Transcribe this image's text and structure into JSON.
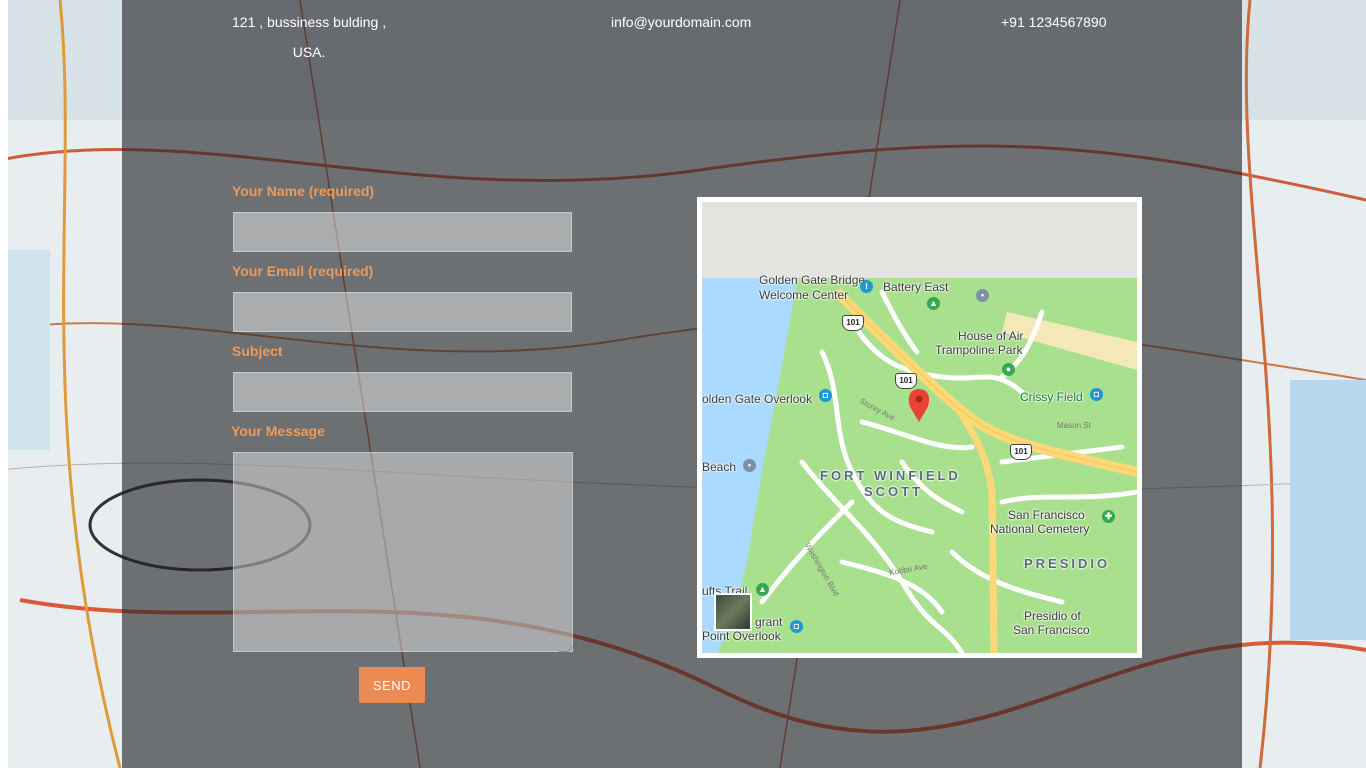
{
  "contact": {
    "address_line1": "121 , bussiness bulding ,",
    "address_line2": "USA.",
    "email": "info@yourdomain.com",
    "phone": "+91 1234567890"
  },
  "form": {
    "name_label": "Your Name (required)",
    "email_label": "Your Email (required)",
    "subject_label": "Subject",
    "message_label": "Your Message",
    "name_value": "",
    "email_value": "",
    "subject_value": "",
    "message_value": "",
    "send_label": "SEND"
  },
  "map": {
    "labels": {
      "golden_gate_bridge": "Golden Gate Bridge",
      "welcome_center": "Welcome Center",
      "battery_east": "Battery East",
      "house_of_air": "House of Air",
      "trampoline_park": "Trampoline Park",
      "golden_gate_overlook": "olden Gate Overlook",
      "crissy_field": "Crissy Field",
      "beach": "Beach",
      "fort_winfield": "FORT WINFIELD",
      "scott": "SCOTT",
      "sf_national": "San Francisco",
      "national_cemetery": "National Cemetery",
      "presidio": "PRESIDIO",
      "presidio_of": "Presidio of",
      "presidio_sf": "San Francisco",
      "trail": "ufts Trail",
      "immigrant": "grant",
      "point_overlook": "Point Overlook",
      "storey_ave": "Storey Ave",
      "mason_st": "Mason St",
      "kobbe_ave": "Kobbe Ave",
      "washington_blvd": "Washington Blvd",
      "lincoln_blvd": "Lincoln Blvd",
      "hwy_101": "101"
    },
    "colors": {
      "land": "#a8e08e",
      "water": "#aadaff",
      "road": "#ffffff",
      "highway": "#fdd878",
      "top_band": "#e5e3df",
      "pin": "#ea4335"
    }
  },
  "theme": {
    "accent": "#ec8a52",
    "label_color": "#ef9a58"
  }
}
